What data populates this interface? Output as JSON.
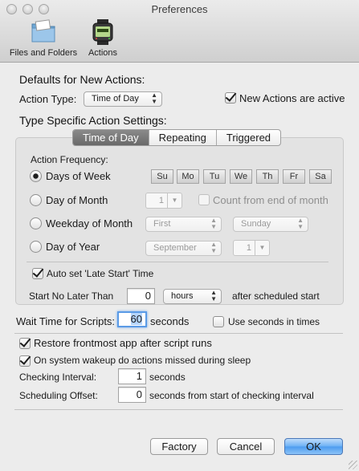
{
  "window": {
    "title": "Preferences"
  },
  "toolbar": [
    {
      "label": "Files and Folders",
      "icon": "folder-icon"
    },
    {
      "label": "Actions",
      "icon": "watch-icon"
    }
  ],
  "defaults": {
    "heading": "Defaults for New Actions:",
    "action_type_label": "Action Type:",
    "action_type_value": "Time of Day",
    "new_active_label": "New Actions are active",
    "new_active_checked": true
  },
  "specific": {
    "heading": "Type Specific Action Settings:",
    "tabs": [
      "Time of Day",
      "Repeating",
      "Triggered"
    ],
    "selected_tab": "Time of Day",
    "frequency_label": "Action Frequency:",
    "days_of_week_label": "Days of Week",
    "days": [
      "Su",
      "Mo",
      "Tu",
      "We",
      "Th",
      "Fr",
      "Sa"
    ],
    "day_of_month_label": "Day of Month",
    "day_of_month_value": "1",
    "count_from_end_label": "Count from end of month",
    "weekday_of_month_label": "Weekday of Month",
    "weekday_ordinal_value": "First",
    "weekday_day_value": "Sunday",
    "day_of_year_label": "Day of Year",
    "month_value": "September",
    "day_of_year_value": "1",
    "auto_late_start_label": "Auto set 'Late Start' Time",
    "auto_late_start_checked": true,
    "start_no_later_label": "Start No Later Than",
    "start_no_later_value": "0",
    "start_unit_value": "hours",
    "after_scheduled_label": "after scheduled start"
  },
  "scripts": {
    "wait_label": "Wait Time for Scripts:",
    "wait_value": "60",
    "wait_unit": "seconds",
    "use_seconds_label": "Use seconds in times",
    "use_seconds_checked": false
  },
  "general": {
    "restore_label": "Restore frontmost app after script runs",
    "restore_checked": true,
    "wakeup_label": "On system wakeup do actions missed during sleep",
    "wakeup_checked": true,
    "checking_label": "Checking Interval:",
    "checking_value": "1",
    "checking_unit": "seconds",
    "offset_label": "Scheduling Offset:",
    "offset_value": "0",
    "offset_unit": "seconds from start of checking interval"
  },
  "buttons": {
    "factory": "Factory",
    "cancel": "Cancel",
    "ok": "OK"
  },
  "colors": {
    "accent": "#4c9bef",
    "focus_ring": "#5b9be6",
    "selected_tab": "#6a6a6a"
  }
}
